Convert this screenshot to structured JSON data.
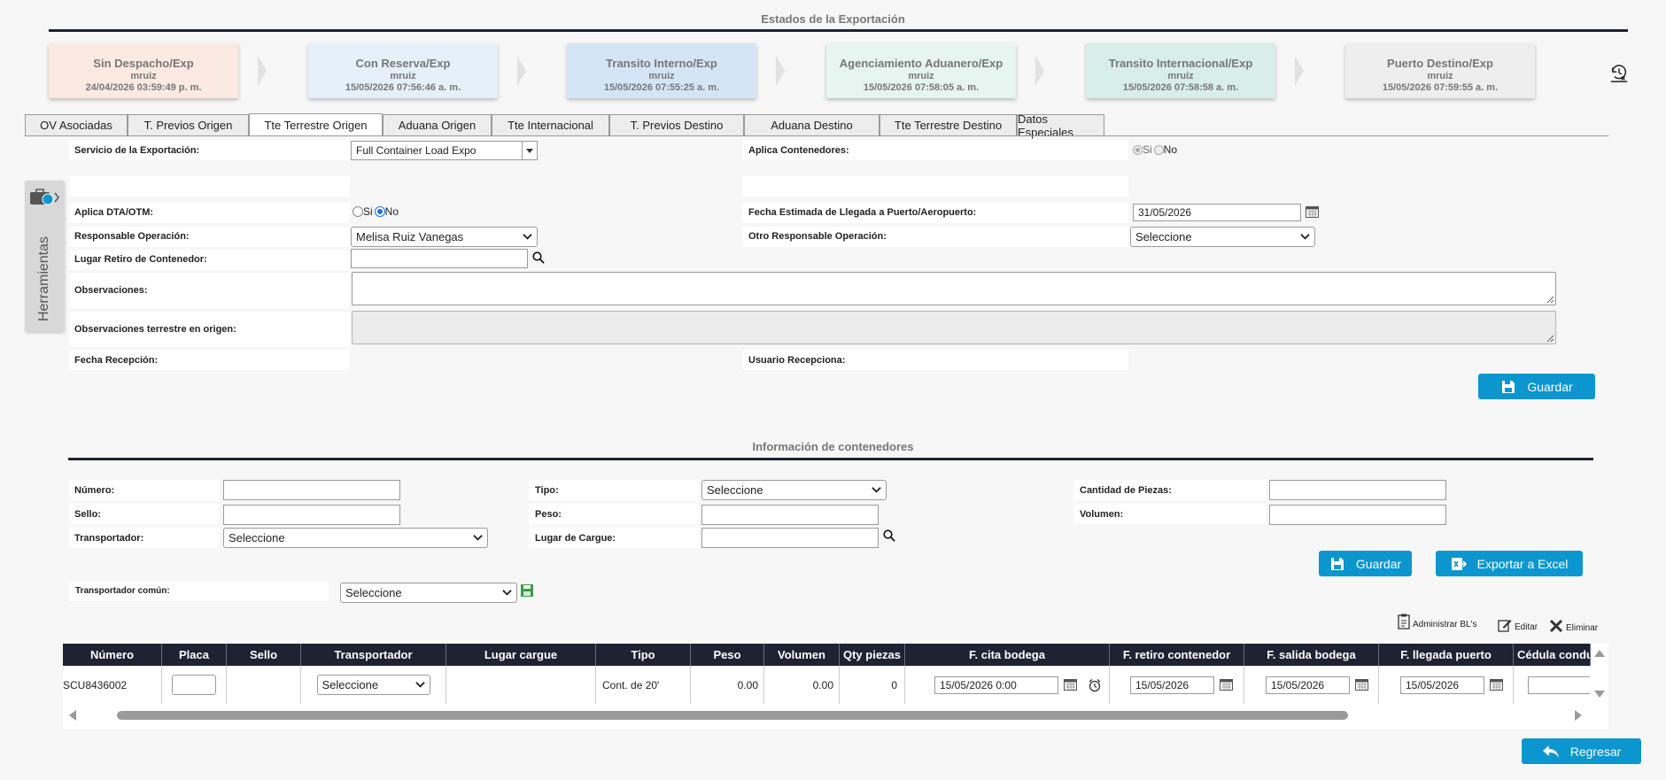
{
  "states_title": "Estados de la Exportación",
  "states": [
    {
      "name": "Sin Despacho/Exp",
      "user": "mruiz",
      "date": "24/04/2026 03:59:49 p. m.",
      "color": "#fbeae1"
    },
    {
      "name": "Con Reserva/Exp",
      "user": "mruiz",
      "date": "15/05/2026 07:56:46 a. m.",
      "color": "#e5f0fa"
    },
    {
      "name": "Transito Interno/Exp",
      "user": "mruiz",
      "date": "15/05/2026 07:55:25 a. m.",
      "color": "#d4e6f6"
    },
    {
      "name": "Agenciamiento Aduanero/Exp",
      "user": "mruiz",
      "date": "15/05/2026 07:58:05 a. m.",
      "color": "#e6f5ef"
    },
    {
      "name": "Transito Internacional/Exp",
      "user": "mruiz",
      "date": "15/05/2026 07:58:58 a. m.",
      "color": "#d8eee8"
    },
    {
      "name": "Puerto Destino/Exp",
      "user": "mruiz",
      "date": "15/05/2026 07:59:55 a. m.",
      "color": "#eeeeee"
    }
  ],
  "tabs": [
    "OV Asociadas",
    "T. Previos Origen",
    "Tte Terrestre Origen",
    "Aduana Origen",
    "Tte Internacional",
    "T. Previos Destino",
    "Aduana Destino",
    "Tte Terrestre Destino",
    "Datos Especiales"
  ],
  "active_tab": "Tte Terrestre Origen",
  "tools_label": "Herramientas",
  "form": {
    "servicio_label": "Servicio de la Exportación:",
    "servicio_value": "Full Container Load Expo",
    "aplica_cont_label": "Aplica Contenedores:",
    "si": "Si",
    "no": "No",
    "dta_label": "Aplica DTA/OTM:",
    "fecha_est_label": "Fecha Estimada de Llegada a Puerto/Aeropuerto:",
    "fecha_est_value": "31/05/2026",
    "resp_label": "Responsable Operación:",
    "resp_value": "Melisa Ruiz Vanegas",
    "otro_resp_label": "Otro Responsable Operación:",
    "otro_resp_value": "Seleccione",
    "lugar_label": "Lugar Retiro de Contenedor:",
    "obs_label": "Observaciones:",
    "obs_terr_label": "Observaciones terrestre en origen:",
    "fecha_rec_label": "Fecha Recepción:",
    "usuario_rec_label": "Usuario Recepciona:",
    "guardar": "Guardar"
  },
  "containers": {
    "title": "Información de contenedores",
    "numero_label": "Número:",
    "sello_label": "Sello:",
    "transp_label": "Transportador:",
    "transp_value": "Seleccione",
    "tipo_label": "Tipo:",
    "tipo_value": "Seleccione",
    "peso_label": "Peso:",
    "lugar_cargue_label": "Lugar de Cargue:",
    "cantidad_label": "Cantidad de Piezas:",
    "volumen_label": "Volumen:",
    "guardar": "Guardar",
    "exportar": "Exportar a Excel",
    "transp_comun_label": "Transportador común:",
    "transp_comun_value": "Seleccione",
    "admin_bl": "Administrar BL's",
    "editar": "Editar",
    "eliminar": "Eliminar"
  },
  "table": {
    "headers": [
      "Número",
      "Placa",
      "Sello",
      "Transportador",
      "Lugar cargue",
      "Tipo",
      "Peso",
      "Volumen",
      "Qty piezas",
      "F. cita bodega",
      "F. retiro contenedor",
      "F. salida bodega",
      "F. llegada puerto",
      "Cédula condu"
    ],
    "row": {
      "numero": "SCU8436002",
      "transportador": "Seleccione",
      "tipo": "Cont. de 20'",
      "peso": "0.00",
      "volumen": "0.00",
      "qty": "0",
      "f_cita": "15/05/2026 0:00",
      "f_retiro": "15/05/2026",
      "f_salida": "15/05/2026",
      "f_llegada": "15/05/2026"
    }
  },
  "regresar": "Regresar"
}
